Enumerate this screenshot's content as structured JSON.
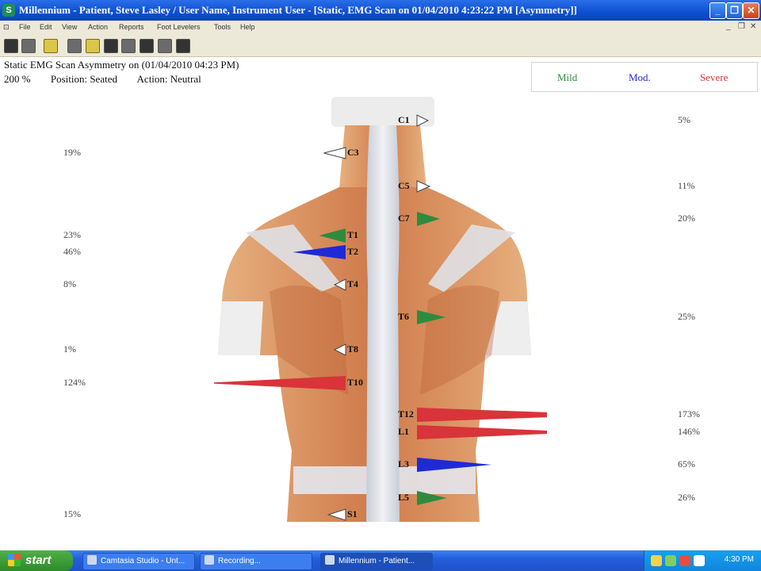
{
  "window": {
    "title": "Millennium - Patient, Steve Lasley / User Name, Instrument User - [Static, EMG Scan on 01/04/2010 4:23:22 PM [Asymmetry]]",
    "controls": [
      "_",
      "❐",
      "✕"
    ]
  },
  "menu": {
    "items": [
      "File",
      "Edit",
      "View",
      "Action",
      "Reports",
      "Foot Levelers",
      "Tools",
      "Help"
    ],
    "mdi_controls": [
      "_",
      "❐",
      "✕"
    ]
  },
  "toolbar": {
    "buttons": [
      "patients-icon",
      "record-icon",
      "folder-icon",
      "scan-icon",
      "pencil-icon",
      "grid-icon",
      "print-icon",
      "report-icon",
      "export-icon",
      "door-icon"
    ]
  },
  "report": {
    "heading": "Static EMG Scan Asymmetry on (01/04/2010 04:23 PM)",
    "zoom": "200 %",
    "position": "Position: Seated",
    "action": "Action: Neutral"
  },
  "legend": {
    "mild": "Mild",
    "mild_color": "#2e8b3e",
    "mod": "Mod.",
    "mod_color": "#1f2ad6",
    "severe": "Severe",
    "severe_color": "#d8343a"
  },
  "levels": [
    {
      "label": "C1",
      "pct": "5%",
      "side": "right",
      "severity": "none"
    },
    {
      "label": "C3",
      "pct": "19%",
      "side": "left",
      "severity": "none"
    },
    {
      "label": "C5",
      "pct": "11%",
      "side": "right",
      "severity": "none"
    },
    {
      "label": "C7",
      "pct": "20%",
      "side": "right",
      "severity": "mild"
    },
    {
      "label": "T1",
      "pct": "23%",
      "side": "left",
      "severity": "mild"
    },
    {
      "label": "T2",
      "pct": "46%",
      "side": "left",
      "severity": "moderate"
    },
    {
      "label": "T4",
      "pct": "8%",
      "side": "left",
      "severity": "none"
    },
    {
      "label": "T6",
      "pct": "25%",
      "side": "right",
      "severity": "mild"
    },
    {
      "label": "T8",
      "pct": "1%",
      "side": "left",
      "severity": "none"
    },
    {
      "label": "T10",
      "pct": "124%",
      "side": "left",
      "severity": "severe"
    },
    {
      "label": "T12",
      "pct": "173%",
      "side": "right",
      "severity": "severe"
    },
    {
      "label": "L1",
      "pct": "146%",
      "side": "right",
      "severity": "severe"
    },
    {
      "label": "L3",
      "pct": "65%",
      "side": "right",
      "severity": "moderate"
    },
    {
      "label": "L5",
      "pct": "26%",
      "side": "right",
      "severity": "mild"
    },
    {
      "label": "S1",
      "pct": "15%",
      "side": "left",
      "severity": "none"
    }
  ],
  "taskbar": {
    "start": "start",
    "tasks": [
      "Camtasia Studio - Unt...",
      "Recording...",
      "Millennium - Patient..."
    ],
    "clock": "4:30 PM"
  }
}
